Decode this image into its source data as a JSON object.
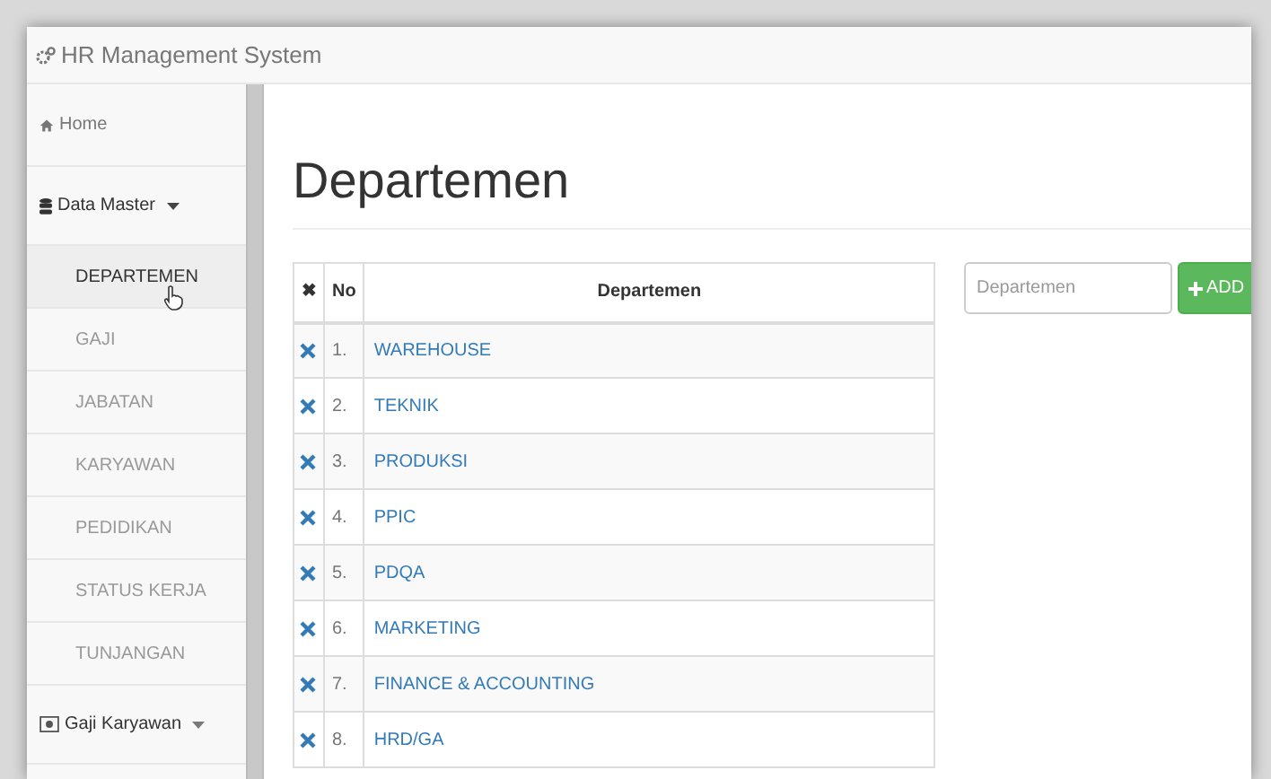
{
  "window": {
    "title": "HR Management System"
  },
  "sidebar": {
    "items": [
      {
        "label": "Home",
        "kind": "link"
      },
      {
        "label": "Data Master",
        "kind": "menu",
        "expanded": true,
        "children": [
          {
            "label": "DEPARTEMEN",
            "selected": true
          },
          {
            "label": "GAJI",
            "selected": false
          },
          {
            "label": "JABATAN",
            "selected": false
          },
          {
            "label": "KARYAWAN",
            "selected": false
          },
          {
            "label": "PEDIDIKAN",
            "selected": false
          },
          {
            "label": "STATUS KERJA",
            "selected": false
          },
          {
            "label": "TUNJANGAN",
            "selected": false
          }
        ]
      },
      {
        "label": "Gaji Karyawan",
        "kind": "menu",
        "expanded": false
      }
    ]
  },
  "page": {
    "title": "Departemen"
  },
  "table": {
    "columns": [
      "✖",
      "No",
      "Departemen"
    ],
    "rows": [
      {
        "no": "1.",
        "name": "WAREHOUSE"
      },
      {
        "no": "2.",
        "name": "TEKNIK"
      },
      {
        "no": "3.",
        "name": "PRODUKSI"
      },
      {
        "no": "4.",
        "name": "PPIC"
      },
      {
        "no": "5.",
        "name": "PDQA"
      },
      {
        "no": "6.",
        "name": "MARKETING"
      },
      {
        "no": "7.",
        "name": "FINANCE & ACCOUNTING"
      },
      {
        "no": "8.",
        "name": "HRD/GA"
      }
    ]
  },
  "form": {
    "placeholder": "Departemen",
    "button": "ADD"
  }
}
